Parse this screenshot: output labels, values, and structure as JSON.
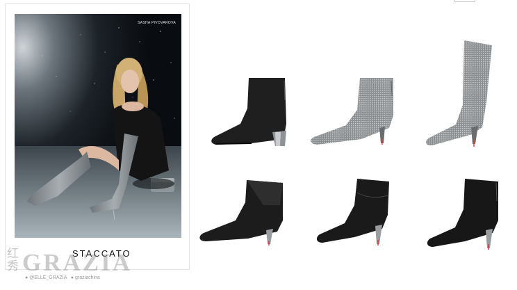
{
  "ad": {
    "credit": "SASHA PIVOVAROVA",
    "brand": "STACCATO"
  },
  "watermark": {
    "chinese": "红秀",
    "logo": "GRAZIA",
    "line_a": "@ELLE_GRAZIA",
    "line_b": "graziachina"
  },
  "shoes": [
    {
      "name": "black-suede-block-heel-ankle-boot",
      "color": "#1e1e1e"
    },
    {
      "name": "glitter-kitten-heel-ankle-boot",
      "color": "#9a9a9a"
    },
    {
      "name": "glitter-knee-high-boot",
      "color": "#9a9a9a"
    },
    {
      "name": "black-leather-elastic-ankle-boot",
      "color": "#1a1a1a"
    },
    {
      "name": "black-leather-panel-ankle-boot",
      "color": "#1a1a1a"
    },
    {
      "name": "black-leather-stiletto-ankle-boot",
      "color": "#1a1a1a"
    }
  ]
}
